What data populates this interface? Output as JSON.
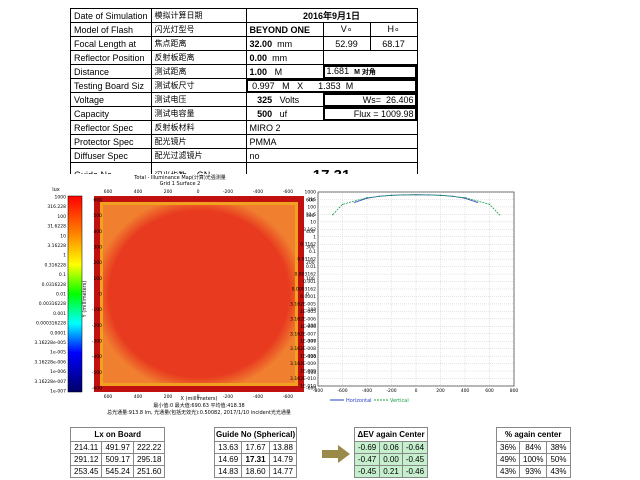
{
  "spec": {
    "date_label": "Date of Simulation",
    "date_cn": "模拟计算日期",
    "date_value": "2016年9月1日",
    "model_label": "Model of Flash",
    "model_cn": "闪光灯型号",
    "model_value": "BEYOND ONE",
    "v_label": "V∘",
    "h_label": "H∘",
    "focal_label": "Focal Length at",
    "focal_cn": "焦点距离",
    "focal_value": "32.00",
    "focal_unit": "mm",
    "v_value": "52.99",
    "h_value": "68.17",
    "refl_pos_label": "Reflector Position",
    "refl_pos_cn": "反射板距离",
    "refl_pos_value": "0.00",
    "refl_pos_unit": "mm",
    "distance_label": "Distance",
    "distance_cn": "测试距离",
    "distance_value": "1.00",
    "distance_unit": "M",
    "diag_value": "1.681",
    "diag_unit": "M 对角",
    "board_label": "Testing Board Siz",
    "board_cn": "测试板尺寸",
    "board_w": "0.997",
    "board_w_unit": "M",
    "board_x": "X",
    "board_h": "1.353",
    "board_h_unit": "M",
    "voltage_label": "Voltage",
    "voltage_cn": "测试电压",
    "voltage_value": "325",
    "voltage_unit": "Volts",
    "ws_label": "Ws=",
    "ws_value": "26.406",
    "capacity_label": "Capacity",
    "capacity_cn": "测试电容量",
    "capacity_value": "500",
    "capacity_unit": "uf",
    "flux_label": "Flux =",
    "flux_value": "1009.98",
    "refl_spec_label": "Reflector Spec",
    "refl_spec_cn": "反射板材料",
    "refl_spec_value": "MIRO 2",
    "prot_label": "Protector Spec",
    "prot_cn": "配光镜片",
    "prot_value": "PMMA",
    "diff_label": "Diffuser Spec",
    "diff_cn": "配光过滤镜片",
    "diff_value": "no",
    "gn_label": "Guide No",
    "gn_cn": "闪光指数",
    "gn_unit": "GN",
    "gn_value": "17.31"
  },
  "sim": {
    "title": "Total - Illuminance Map(计算)光强测量",
    "subtitle": "Grid 1 Surface 2",
    "unit": "lux",
    "legend": [
      "1000",
      "316.228",
      "100",
      "31.6228",
      "10",
      "3.16228",
      "1",
      "0.316228",
      "0.1",
      "0.0316228",
      "0.01",
      "0.00316228",
      "0.001",
      "0.000316228",
      "0.0001",
      "3.16228e-005",
      "1e-005",
      "3.16228e-006",
      "1e-006",
      "3.16228e-007",
      "1e-007"
    ],
    "x_ticks": [
      "600",
      "400",
      "200",
      "0",
      "-200",
      "-400",
      "-600"
    ],
    "y_ticks": [
      "600",
      "500",
      "400",
      "300",
      "200",
      "100",
      "0",
      "-100",
      "-200",
      "-300",
      "-400",
      "-500",
      "-600"
    ],
    "y_axis_label": "Y (millimeters)",
    "x_axis_label": "X (millimeters)",
    "footer1": "最小值:0  最大值:690.63  平均值:418.38",
    "footer2": "总光通量:913.8 lm, 光通量(包括无效光):0.50082, 2017/1/10 incident光光通量",
    "log_ticks": [
      "1000",
      "316",
      "100",
      "31.6",
      "10",
      "3.162",
      "1",
      "0.3162",
      "0.1",
      "0.03162",
      "0.01",
      "0.003162",
      "0.001",
      "0.0003162",
      "0.0001",
      "3.162E-005",
      "1E-005",
      "3.162E-006",
      "1E-006",
      "3.162E-007",
      "1E-007",
      "3.162E-008",
      "1E-008",
      "3.162E-009",
      "1E-009",
      "3.162E-010",
      "1E-010"
    ],
    "plot_x_ticks": [
      "-800",
      "-600",
      "-400",
      "-200",
      "0",
      "200",
      "400",
      "600",
      "800"
    ],
    "legend_h": "Horizontal",
    "legend_v": "Vertical"
  },
  "lx_board": {
    "header": "Lx on Board",
    "rows": [
      [
        "214.11",
        "491.97",
        "222.22"
      ],
      [
        "291.12",
        "509.17",
        "295.18"
      ],
      [
        "253.45",
        "545.24",
        "251.60"
      ]
    ]
  },
  "guide_no": {
    "header": "Guide No (Spherical)",
    "rows": [
      [
        "13.63",
        "17.67",
        "13.88"
      ],
      [
        "14.69",
        "17.31",
        "14.79"
      ],
      [
        "14.83",
        "18.60",
        "14.77"
      ]
    ]
  },
  "delta_ev": {
    "header": "ΔEV again Center",
    "rows": [
      [
        "-0.69",
        "0.06",
        "-0.64"
      ],
      [
        "-0.47",
        "0.00",
        "-0.45"
      ],
      [
        "-0.45",
        "0.21",
        "-0.46"
      ]
    ]
  },
  "percent": {
    "header": "%  again center",
    "rows": [
      [
        "36%",
        "84%",
        "38%"
      ],
      [
        "49%",
        "100%",
        "50%"
      ],
      [
        "43%",
        "93%",
        "43%"
      ]
    ]
  },
  "colors": {
    "map_fill": "#e83a1f",
    "map_edge": "#f2a020",
    "arrow": "#9a8a4a",
    "green_cell": "#c6efce",
    "h_line": "#2a40c8",
    "v_line": "#1aa04a"
  },
  "chart_data": {
    "type": "line",
    "ylim": [
      1e-10,
      1000
    ],
    "xlim": [
      -800,
      800
    ],
    "series": [
      {
        "name": "Horizontal",
        "x": [
          -500,
          -400,
          -300,
          -200,
          -100,
          0,
          100,
          200,
          300,
          400,
          500
        ],
        "values": [
          200,
          380,
          520,
          600,
          640,
          660,
          640,
          600,
          520,
          380,
          200
        ]
      },
      {
        "name": "Vertical",
        "x": [
          -680,
          -600,
          -400,
          -200,
          0,
          200,
          400,
          600,
          680
        ],
        "values": [
          30,
          150,
          420,
          600,
          660,
          600,
          420,
          150,
          30
        ]
      }
    ]
  }
}
